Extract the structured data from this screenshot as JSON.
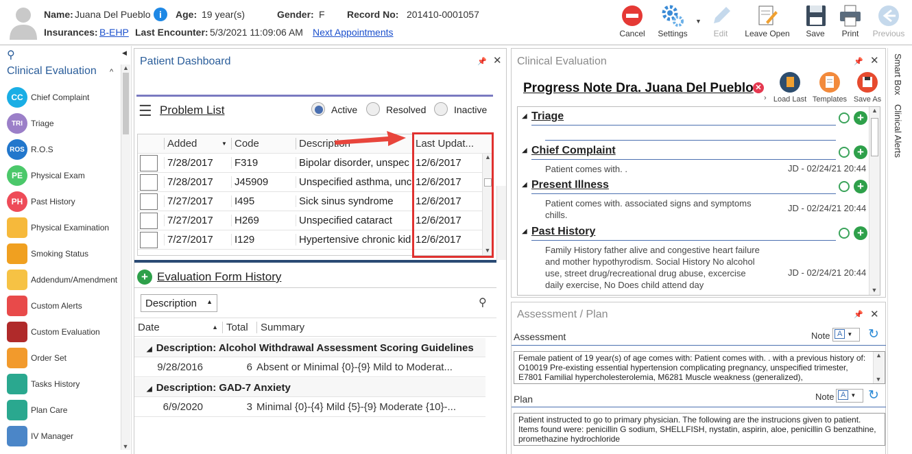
{
  "header": {
    "name_label": "Name:",
    "name_value": "Juana Del Pueblo",
    "age_label": "Age:",
    "age_value": "19 year(s)",
    "gender_label": "Gender:",
    "gender_value": "F",
    "record_label": "Record No:",
    "record_value": "201410-0001057",
    "insurances_label": "Insurances:",
    "insurances_value": "B-EHP",
    "last_encounter_label": "Last Encounter:",
    "last_encounter_value": "5/3/2021 11:09:06 AM",
    "next_appointments": "Next Appointments"
  },
  "toolbar": {
    "cancel": "Cancel",
    "settings": "Settings",
    "edit": "Edit",
    "leave_open": "Leave Open",
    "save": "Save",
    "print": "Print",
    "previous": "Previous"
  },
  "sidebar": {
    "title": "Clinical Evaluation",
    "items": [
      {
        "label": "Chief Complaint",
        "abbr": "CC"
      },
      {
        "label": "Triage",
        "abbr": "TRI"
      },
      {
        "label": "R.O.S",
        "abbr": "ROS"
      },
      {
        "label": "Physical Exam",
        "abbr": "PE"
      },
      {
        "label": "Past History",
        "abbr": "PH"
      },
      {
        "label": "Physical Examination",
        "abbr": ""
      },
      {
        "label": "Smoking Status",
        "abbr": ""
      },
      {
        "label": "Addendum/Amendment",
        "abbr": ""
      },
      {
        "label": "Custom Alerts",
        "abbr": ""
      },
      {
        "label": "Custom Evaluation",
        "abbr": ""
      },
      {
        "label": "Order Set",
        "abbr": ""
      },
      {
        "label": "Tasks History",
        "abbr": ""
      },
      {
        "label": "Plan Care",
        "abbr": ""
      },
      {
        "label": "IV Manager",
        "abbr": ""
      }
    ]
  },
  "dashboard": {
    "title": "Patient Dashboard",
    "problem_list": "Problem List",
    "filters": [
      "Active",
      "Resolved",
      "Inactive"
    ],
    "columns": [
      "Added",
      "Code",
      "Description",
      "Last Updat..."
    ],
    "rows": [
      {
        "added": "7/28/2017",
        "code": "F319",
        "desc": "Bipolar disorder, unspec",
        "updated": "12/6/2017"
      },
      {
        "added": "7/28/2017",
        "code": "J45909",
        "desc": "Unspecified asthma, unc",
        "updated": "12/6/2017"
      },
      {
        "added": "7/27/2017",
        "code": "I495",
        "desc": "Sick sinus syndrome",
        "updated": "12/6/2017"
      },
      {
        "added": "7/27/2017",
        "code": "H269",
        "desc": "Unspecified cataract",
        "updated": "12/6/2017"
      },
      {
        "added": "7/27/2017",
        "code": "I129",
        "desc": "Hypertensive chronic kid",
        "updated": "12/6/2017"
      }
    ],
    "eval_history": "Evaluation Form History",
    "group_by": "Description",
    "eval_columns": [
      "Date",
      "Total",
      "Summary"
    ],
    "groups": [
      {
        "title": "Description: Alcohol Withdrawal Assessment Scoring Guidelines",
        "date": "9/28/2016",
        "total": "6",
        "summary": "Absent or Minimal {0}-{9}  Mild to Moderat..."
      },
      {
        "title": "Description: GAD-7 Anxiety",
        "date": "6/9/2020",
        "total": "3",
        "summary": "Minimal {0}-{4}  Mild {5}-{9}  Moderate {10}-..."
      }
    ]
  },
  "clinical": {
    "title": "Clinical Evaluation",
    "note_title": "Progress Note Dra. Juana Del Pueblo",
    "load_last": "Load Last",
    "templates": "Templates",
    "save_as": "Save As",
    "sections": [
      {
        "name": "Triage",
        "text": "",
        "stamp": ""
      },
      {
        "name": "Chief Complaint",
        "text": "Patient comes with. .",
        "stamp": "JD - 02/24/21 20:44"
      },
      {
        "name": "Present Illness",
        "text": "Patient comes with. associated signs and symptoms chills.",
        "stamp": "JD - 02/24/21 20:44"
      },
      {
        "name": "Past History",
        "text": "Family History father alive and congestive heart failure and mother hypothyrodism. Social History No alcohol use, street drug/recreational drug abuse, excercise daily exercise, No Does child attend day",
        "stamp": "JD - 02/24/21 20:44"
      }
    ]
  },
  "assessment": {
    "title": "Assessment / Plan",
    "assessment_label": "Assessment",
    "note_label": "Note",
    "assessment_text": "Female patient of 19 year(s) of age comes with:  Patient comes with. .     with a previous history of: O10019 Pre-existing essential hypertension complicating pregnancy, unspecified trimester, E7801 Familial hypercholesterolemia, M6281 Muscle weakness (generalized),",
    "plan_label": "Plan",
    "plan_text": "      Patient instructed to go to primary physician.  The following are the instrucions given to patient.     Items found were:  penicillin G sodium, SHELLFISH, nystatin, aspirin, aloe, penicillin G benzathine, promethazine hydrochloride"
  },
  "side_tabs": [
    "Smart Box",
    "Clinical Alerts"
  ],
  "colors": {
    "accent": "#2a5d9a",
    "highlight": "#e0312f",
    "green": "#2ea04a"
  }
}
